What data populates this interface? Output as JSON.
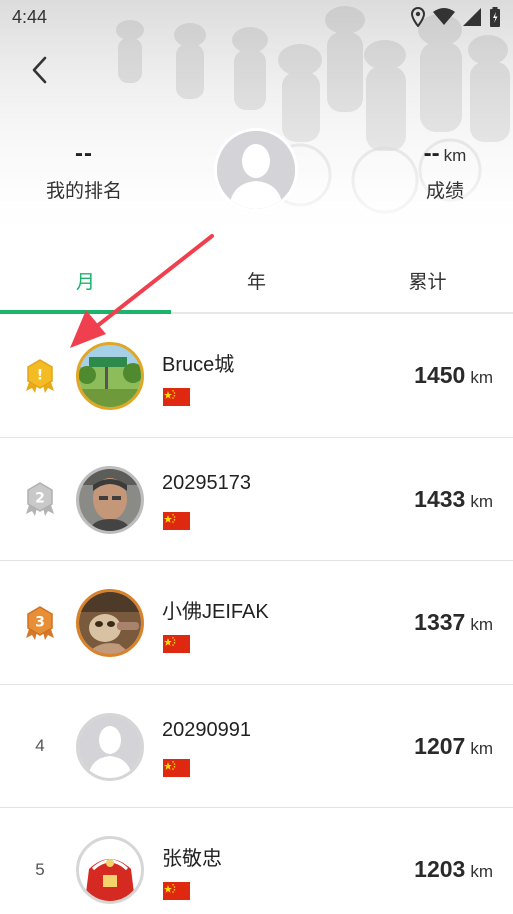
{
  "status_bar": {
    "time": "4:44"
  },
  "header": {
    "my_rank_value": "--",
    "my_rank_label": "我的排名",
    "score_value": "--",
    "score_unit": "km",
    "score_label": "成绩"
  },
  "tabs": [
    {
      "label": "月",
      "active": true
    },
    {
      "label": "年",
      "active": false
    },
    {
      "label": "累计",
      "active": false
    }
  ],
  "rows": [
    {
      "rank": "1",
      "badge": "gold-medal-icon",
      "name": "Bruce城",
      "distance": "1450",
      "unit": "km"
    },
    {
      "rank": "2",
      "badge": "silver-medal-icon",
      "name": "20295173",
      "distance": "1433",
      "unit": "km"
    },
    {
      "rank": "3",
      "badge": "bronze-medal-icon",
      "name": "小佛JEIFAK",
      "distance": "1337",
      "unit": "km"
    },
    {
      "rank": "4",
      "badge": "",
      "name": "20290991",
      "distance": "1207",
      "unit": "km"
    },
    {
      "rank": "5",
      "badge": "",
      "name": "张敬忠",
      "distance": "1203",
      "unit": "km"
    }
  ],
  "colors": {
    "accent": "#1cb36b",
    "gold": "#f2b721",
    "silver": "#bfbfbf",
    "bronze": "#e08a2c",
    "annotation_arrow": "#f0404f"
  }
}
